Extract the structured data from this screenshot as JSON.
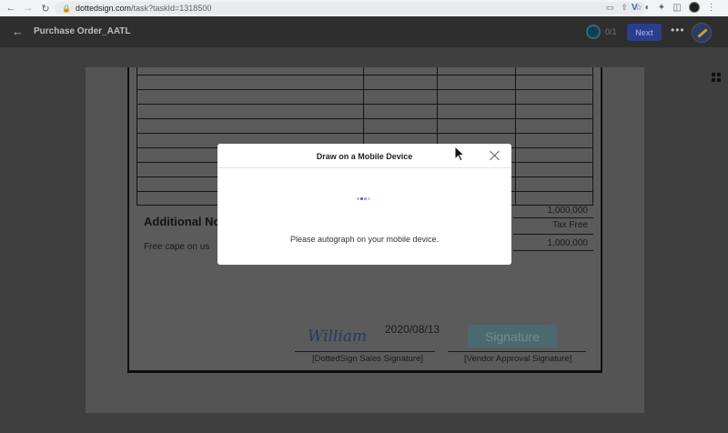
{
  "browser": {
    "url_host": "dottedsign.com",
    "url_path": "/task?taskId=1318500"
  },
  "header": {
    "title": "Purchase Order_AATL",
    "progress": "0/1",
    "next_label": "Next"
  },
  "document": {
    "additional_notes_heading": "Additional No",
    "notes_text": "Free cape on us",
    "totals": [
      "1,000,000",
      "Tax Free",
      "1,000,000"
    ],
    "signature_script": "William",
    "date": "2020/08/13",
    "signature_placeholder": "Signature",
    "required_mark": "*",
    "left_caption": "[DottedSign Sales Signature]",
    "right_caption": "[Vendor Approval Signature]"
  },
  "modal": {
    "title": "Draw on a Mobile Device",
    "message": "Please autograph on your mobile device."
  },
  "colors": {
    "accent": "#2b3d8f",
    "spinner": [
      "#b0b9ff",
      "#4b5cd9",
      "#8ea0ff",
      "#c5ccff"
    ]
  },
  "icons": [
    "back-arrow-icon",
    "forward-arrow-icon",
    "reload-icon",
    "lock-icon",
    "close-icon",
    "more-icon",
    "grid-icon",
    "progress-ring-icon"
  ]
}
